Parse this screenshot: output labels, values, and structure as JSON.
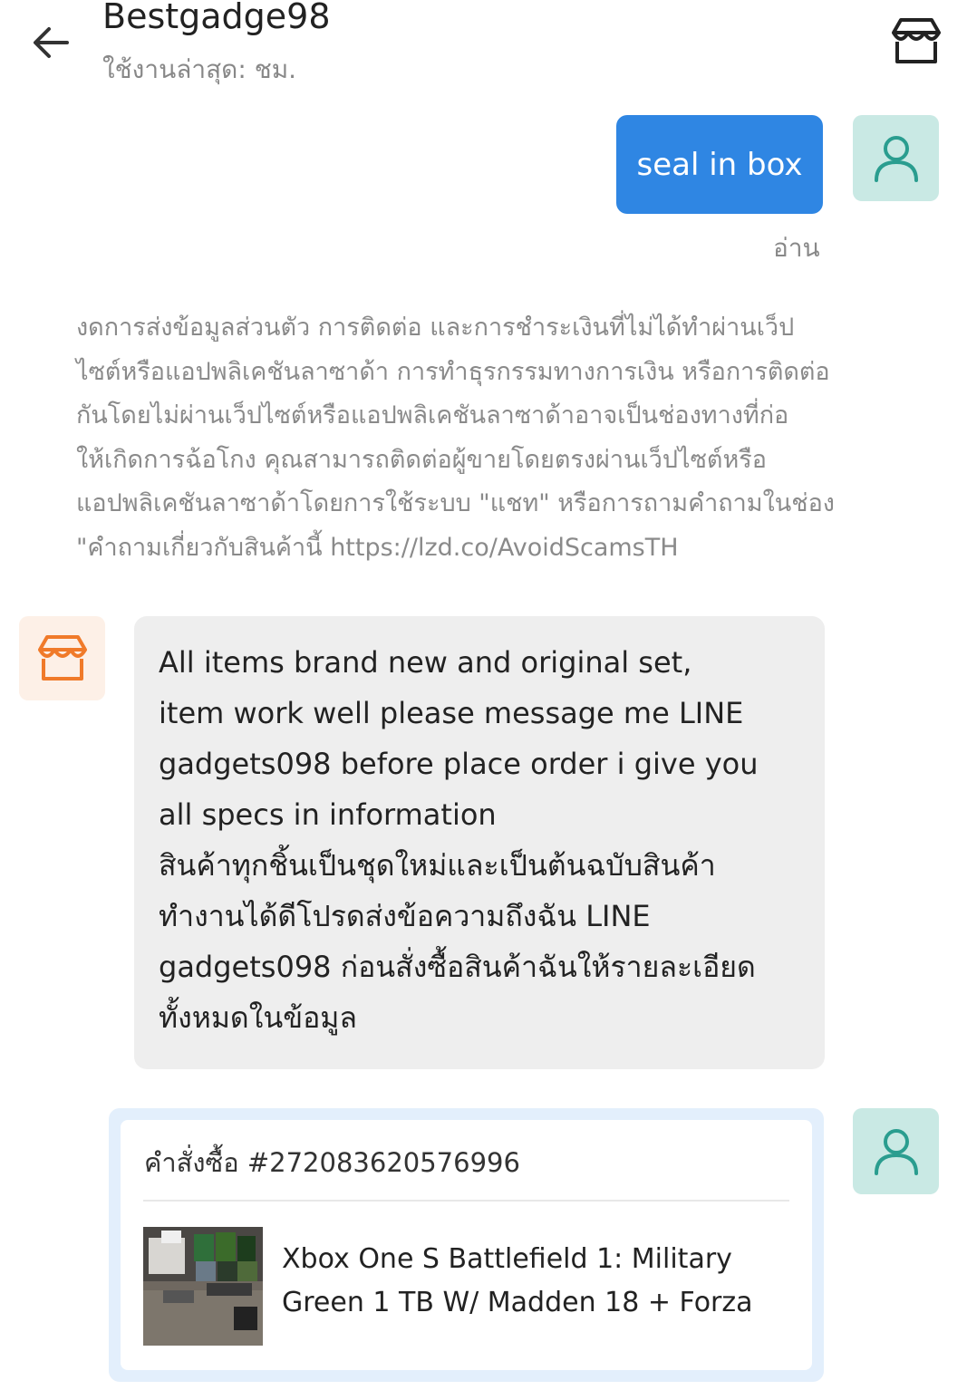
{
  "header": {
    "title": "Bestgadge98",
    "last_active": "ใช้งานล่าสุด: ชม.",
    "back_icon": "arrow-left-icon",
    "store_icon": "store-icon"
  },
  "messages": {
    "sent_text": "seal in box",
    "read_status": "อ่าน",
    "notice_lines": [
      "งดการส่งข้อมูลส่วนตัว การติดต่อ และการชำระเงินที่ไม่ได้ทำผ่านเว็ป",
      "ไซต์หรือแอปพลิเคชันลาซาด้า การทำธุรกรรมทางการเงิน หรือการติดต่อ",
      "กันโดยไม่ผ่านเว็ปไซต์หรือแอปพลิเคชันลาซาด้าอาจเป็นช่องทางที่ก่อ",
      "ให้เกิดการฉ้อโกง คุณสามารถติดต่อผู้ขายโดยตรงผ่านเว็ปไซต์หรือ",
      "แอปพลิเคชันลาซาด้าโดยการใช้ระบบ \"แชท\" หรือการถามคำถามในช่อง",
      "\"คำถามเกี่ยวกับสินค้านี้ https://lzd.co/AvoidScamsTH"
    ],
    "seller_lines": [
      "All items brand new and original set,",
      "item work well please message me LINE",
      "gadgets098 before place order i give you",
      "all specs in information",
      "สินค้าทุกชิ้นเป็นชุดใหม่และเป็นต้นฉบับสินค้า",
      "ทำงานได้ดีโปรดส่งข้อความถึงฉัน LINE",
      "gadgets098 ก่อนสั่งซื้อสินค้าฉันให้รายละเอียด",
      "ทั้งหมดในข้อมูล"
    ]
  },
  "order": {
    "title": "คำสั่งซื้อ #272083620576996",
    "product_name": "Xbox One S Battlefield 1: Military Green 1 TB W/ Madden 18 + Forza"
  },
  "colors": {
    "sent_bubble": "#2f86e3",
    "user_avatar_bg": "#c9e9e4",
    "user_avatar_icon": "#2a9d8f",
    "shop_avatar_bg": "#fdf0e7",
    "shop_avatar_icon": "#f07a2a",
    "received_bubble": "#eeeeee",
    "order_border": "#e3effc"
  }
}
